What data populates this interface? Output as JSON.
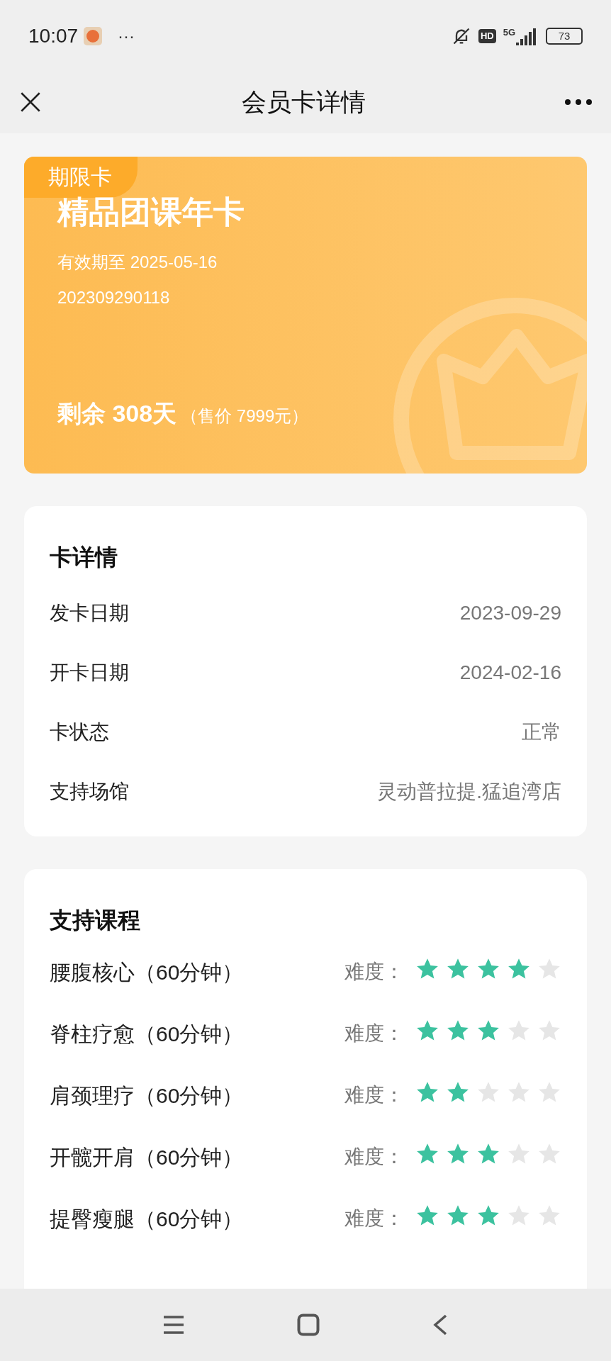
{
  "status_bar": {
    "time": "10:07",
    "more": "···",
    "hd": "HD",
    "network": "5G",
    "battery": "73"
  },
  "header": {
    "title": "会员卡详情"
  },
  "card": {
    "tag": "期限卡",
    "name": "精品团课年卡",
    "expiry": "有效期至 2025-05-16",
    "number": "202309290118",
    "remaining": "剩余 308天",
    "price": "（售价 7999元）"
  },
  "details": {
    "title": "卡详情",
    "rows": [
      {
        "label": "发卡日期",
        "value": "2023-09-29"
      },
      {
        "label": "开卡日期",
        "value": "2024-02-16"
      },
      {
        "label": "卡状态",
        "value": "正常"
      },
      {
        "label": "支持场馆",
        "value": "灵动普拉提.猛追湾店"
      }
    ]
  },
  "courses": {
    "title": "支持课程",
    "items": [
      {
        "name": "腰腹核心（60分钟）",
        "difficulty_label": "难度：",
        "stars": 4
      },
      {
        "name": "脊柱疗愈（60分钟）",
        "difficulty_label": "难度：",
        "stars": 3
      },
      {
        "name": "肩颈理疗（60分钟）",
        "difficulty_label": "难度：",
        "stars": 2
      },
      {
        "name": "开髋开肩（60分钟）",
        "difficulty_label": "难度：",
        "stars": 3
      },
      {
        "name": "提臀瘦腿（60分钟）",
        "difficulty_label": "难度：",
        "stars": 3
      }
    ]
  }
}
